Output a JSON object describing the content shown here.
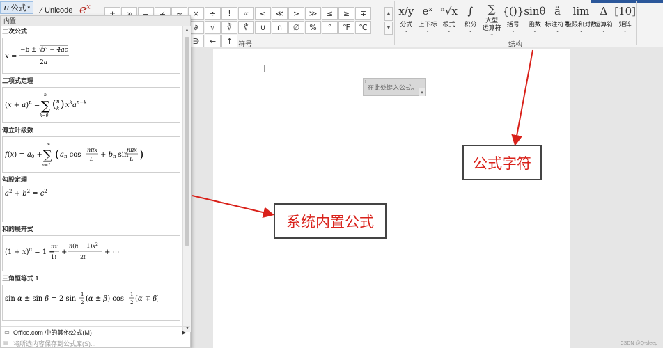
{
  "ribbon": {
    "equation_label": "公式",
    "unicode_label": "Unicode",
    "symbols": [
      "±",
      "∞",
      "=",
      "≠",
      "~",
      "×",
      "÷",
      "!",
      "∝",
      "<",
      "≪",
      ">",
      "≫",
      "≤",
      "≥",
      "∓",
      "≅",
      "≈",
      "≡",
      "∀",
      "∁",
      "∂",
      "√",
      "∛",
      "∜",
      "∪",
      "∩",
      "∅",
      "%",
      "°",
      "℉",
      "℃",
      "∆",
      "∇",
      "∃",
      "∄",
      "∈",
      "∋",
      "←",
      "↑"
    ],
    "symbols_group_label": "符号",
    "structures_group_label": "结构",
    "structures": [
      {
        "glyph": "x/y",
        "label": "分式"
      },
      {
        "glyph": "eˣ",
        "label": "上下标"
      },
      {
        "glyph": "ⁿ√x",
        "label": "根式"
      },
      {
        "glyph": "∫",
        "label": "积分"
      },
      {
        "glyph": "∑",
        "label": "大型\n运算符"
      },
      {
        "glyph": "{()}",
        "label": "括号"
      },
      {
        "glyph": "sinθ",
        "label": "函数"
      },
      {
        "glyph": "ä",
        "label": "标注符号"
      },
      {
        "glyph": "lim",
        "label": "极限和对数"
      },
      {
        "glyph": "Δ",
        "label": "运算符"
      },
      {
        "glyph": "[10]",
        "label": "矩阵"
      }
    ]
  },
  "panel": {
    "header": "内置",
    "items": [
      {
        "caption": "二次公式",
        "formula": "x = −b ± √(b² − 4ac) / 2a"
      },
      {
        "caption": "二项式定理",
        "formula": "(x + a)ⁿ = ∑ₖ₌₀ⁿ (n k) xᵏ aⁿ⁻ᵏ"
      },
      {
        "caption": "傅立叶级数",
        "formula": "f(x) = a₀ + ∑ₙ₌₁^∞ (aₙ cos nπx/L + bₙ sin nπx/L)"
      },
      {
        "caption": "勾股定理",
        "formula": "a² + b² = c²"
      },
      {
        "caption": "和的展开式",
        "formula": "(1 + x)ⁿ = 1 + nx/1! + n(n − 1)x²/2! + ⋯"
      },
      {
        "caption": "三角恒等式 1",
        "formula": "sin α ± sin β = 2 sin ½(α ± β) cos ½(α ∓ β)"
      }
    ],
    "footer_more": "Office.com 中的其他公式(M)",
    "footer_save": "将所选内容保存到公式库(S)..."
  },
  "document": {
    "equation_placeholder": "在此处键入公式。"
  },
  "callouts": {
    "formula_symbols": "公式字符",
    "builtin_formulas": "系统内置公式"
  },
  "watermark": "CSDN @Q-sleep"
}
